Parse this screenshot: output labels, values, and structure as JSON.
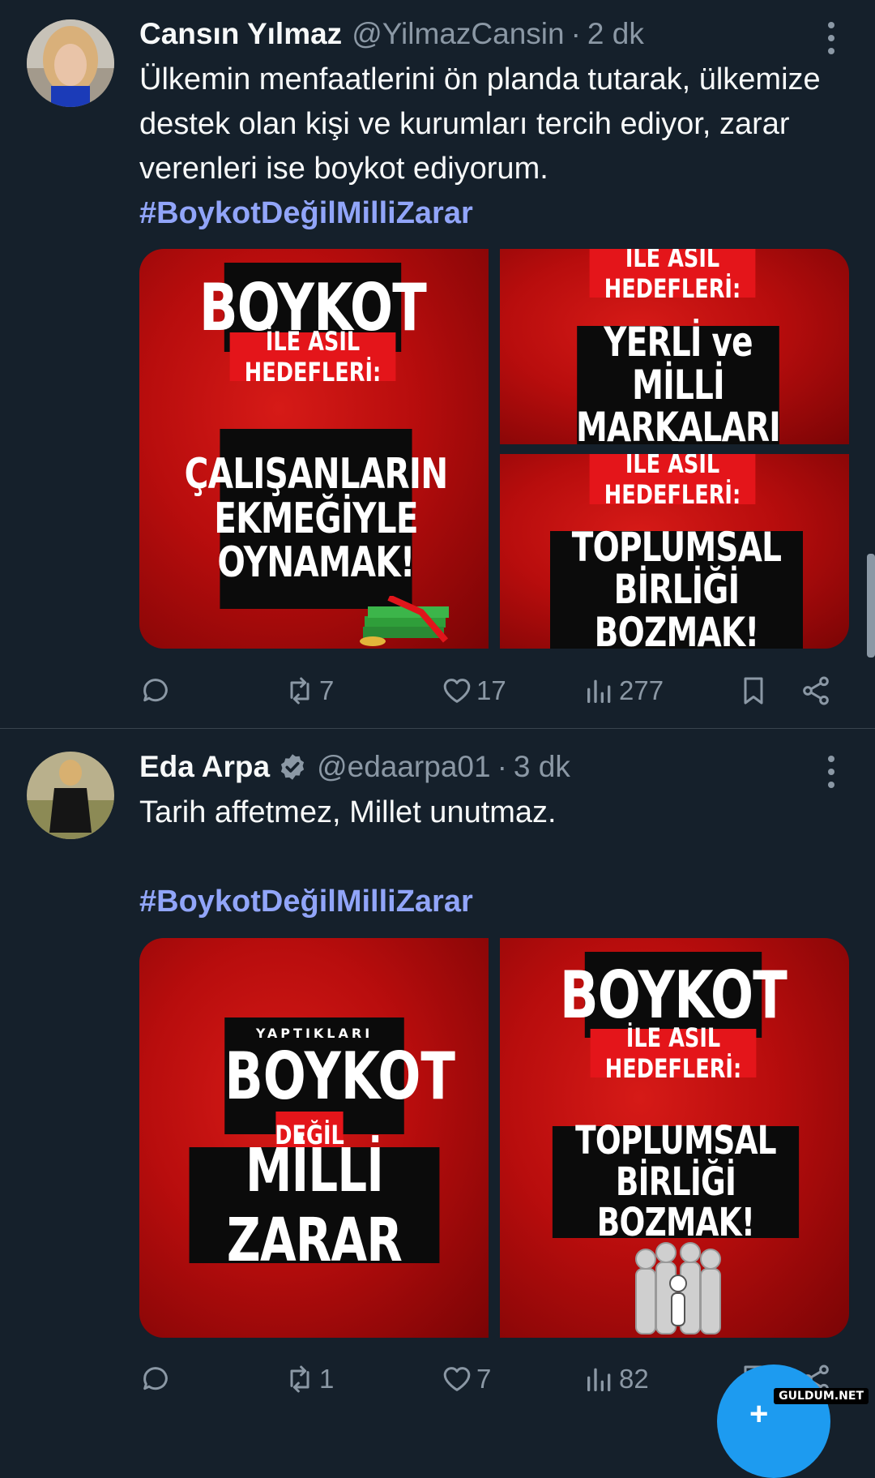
{
  "tweets": [
    {
      "name": "Cansın Yılmaz",
      "handle": "@YilmazCansin",
      "separator": "·",
      "time": "2 dk",
      "text": "Ülkemin menfaatlerini ön planda tutarak, ülkemize destek olan kişi ve kurumları tercih ediyor, zarar verenleri ise boykot ediyorum.",
      "hashtag": "#BoykotDeğilMilliZarar",
      "images": {
        "left": {
          "headline": "BOYKOT",
          "tag": "İLE ASIL HEDEFLERİ:",
          "body_lines": [
            "ÇALIŞANLARIN",
            "EKMEĞİYLE",
            "OYNAMAK!"
          ]
        },
        "top_right": {
          "tag": "İLE ASIL HEDEFLERİ:",
          "body_lines": [
            "YERLİ ve MİLLİ",
            "MARKALARI"
          ]
        },
        "bottom_right": {
          "tag": "İLE ASIL HEDEFLERİ:",
          "body_lines": [
            "TOPLUMSAL BİRLİĞİ",
            "BOZMAK!"
          ]
        }
      },
      "actions": {
        "reposts": "7",
        "likes": "17",
        "views": "277"
      }
    },
    {
      "name": "Eda Arpa",
      "handle": "@edaarpa01",
      "separator": "·",
      "time": "3 dk",
      "text": "Tarih affetmez, Millet unutmaz.",
      "hashtag": "#BoykotDeğilMilliZarar",
      "images": {
        "left": {
          "kicker": "YAPTIKLARI",
          "headline": "BOYKOT",
          "tag": "DEĞİL",
          "body": "MİLLİ ZARAR"
        },
        "right": {
          "headline": "BOYKOT",
          "tag": "İLE ASIL HEDEFLERİ:",
          "body_lines": [
            "TOPLUMSAL BİRLİĞİ",
            "BOZMAK!"
          ]
        }
      },
      "actions": {
        "reposts": "1",
        "likes": "7",
        "views": "82"
      }
    }
  ],
  "watermark": "GULDUM.NET",
  "colors": {
    "background": "#15202b",
    "hashtag": "#91a5f9",
    "muted": "#8b98a5",
    "accent": "#1d9bf0",
    "poster_red": "#c8111a"
  }
}
